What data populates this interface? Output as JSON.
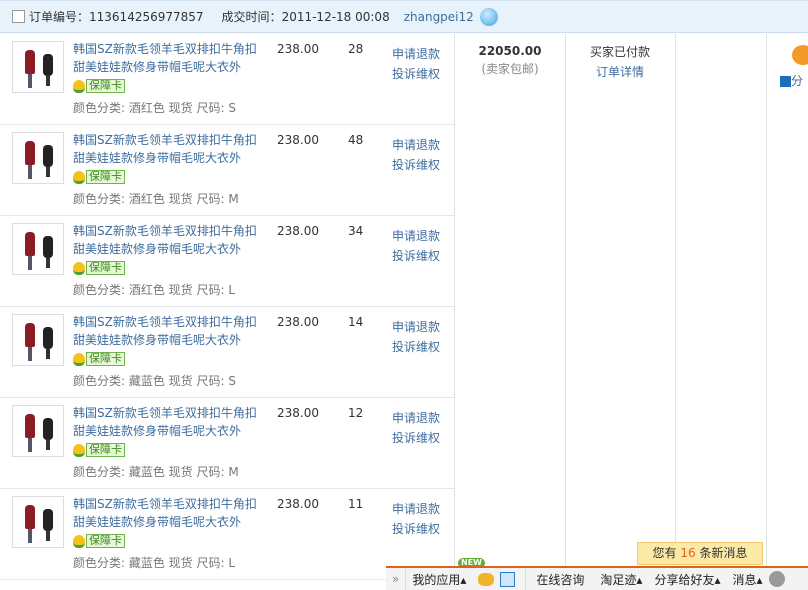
{
  "order": {
    "number_label": "订单编号：",
    "number": "113614256977857",
    "time_label": "成交时间：",
    "time": "2011-12-18 00:08",
    "seller": "zhangpei12"
  },
  "items": [
    {
      "title": "韩国SZ新款毛领羊毛双排扣牛角扣甜美娃娃款修身带帽毛呢大衣外",
      "badge": "保障卡",
      "sku": "颜色分类: 酒红色 现货 尺码: S",
      "price": "238.00",
      "qty": "28",
      "refund": "申请退款",
      "complain": "投诉维权"
    },
    {
      "title": "韩国SZ新款毛领羊毛双排扣牛角扣甜美娃娃款修身带帽毛呢大衣外",
      "badge": "保障卡",
      "sku": "颜色分类: 酒红色 现货 尺码: M",
      "price": "238.00",
      "qty": "48",
      "refund": "申请退款",
      "complain": "投诉维权"
    },
    {
      "title": "韩国SZ新款毛领羊毛双排扣牛角扣甜美娃娃款修身带帽毛呢大衣外",
      "badge": "保障卡",
      "sku": "颜色分类: 酒红色 现货 尺码: L",
      "price": "238.00",
      "qty": "34",
      "refund": "申请退款",
      "complain": "投诉维权"
    },
    {
      "title": "韩国SZ新款毛领羊毛双排扣牛角扣甜美娃娃款修身带帽毛呢大衣外",
      "badge": "保障卡",
      "sku": "颜色分类: 藏蓝色 现货 尺码: S",
      "price": "238.00",
      "qty": "14",
      "refund": "申请退款",
      "complain": "投诉维权"
    },
    {
      "title": "韩国SZ新款毛领羊毛双排扣牛角扣甜美娃娃款修身带帽毛呢大衣外",
      "badge": "保障卡",
      "sku": "颜色分类: 藏蓝色 现货 尺码: M",
      "price": "238.00",
      "qty": "12",
      "refund": "申请退款",
      "complain": "投诉维权"
    },
    {
      "title": "韩国SZ新款毛领羊毛双排扣牛角扣甜美娃娃款修身带帽毛呢大衣外",
      "badge": "保障卡",
      "sku": "颜色分类: 藏蓝色 现货 尺码: L",
      "price": "238.00",
      "qty": "11",
      "refund": "申请退款",
      "complain": "投诉维权"
    }
  ],
  "summary": {
    "total": "22050.00",
    "shipping": "(卖家包邮)",
    "status": "买家已付款",
    "detail_link": "订单详情",
    "share": "分"
  },
  "toolbar": {
    "expand": "»",
    "new_badge": "NEW",
    "my_apps": "我的应用",
    "online": "在线咨询",
    "footprint": "淘足迹",
    "share": "分享给好友",
    "messages": "消息",
    "tip_prefix": "您有",
    "tip_count": "16",
    "tip_suffix": "条新消息"
  },
  "colors": {
    "link": "#3e6d9e",
    "accent": "#e2601b",
    "header_bg": "#e8f2fb"
  }
}
